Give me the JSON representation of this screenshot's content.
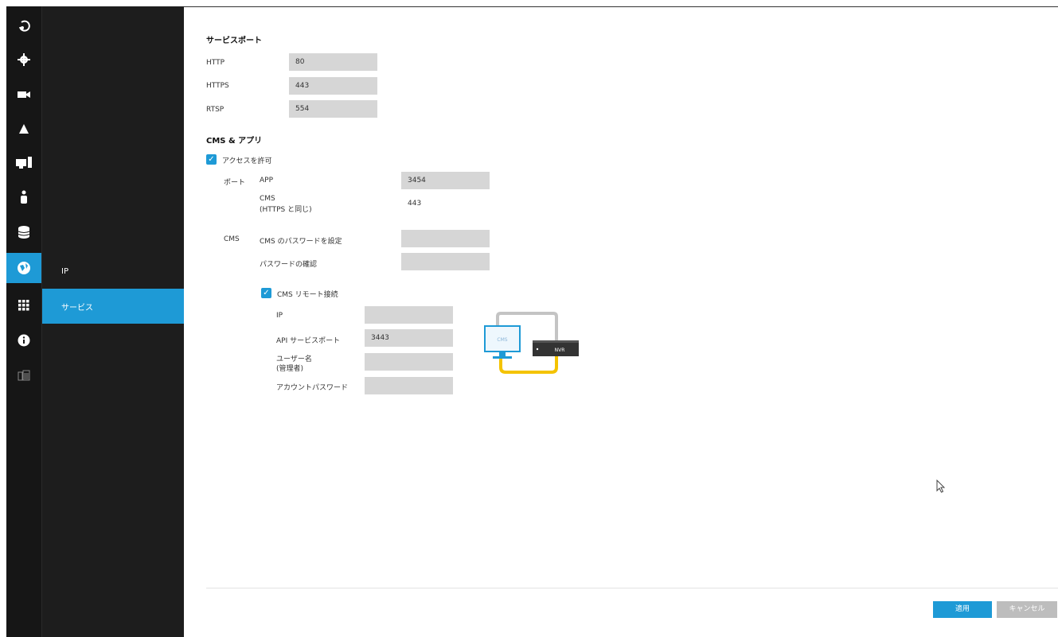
{
  "rail": {
    "icons": [
      "logout-icon",
      "gear-icon",
      "camera-icon",
      "alarm-icon",
      "display-icon",
      "user-icon",
      "storage-icon",
      "network-icon",
      "apps-icon",
      "info-icon",
      "building-icon"
    ]
  },
  "submenu": {
    "items": [
      {
        "label": "IP"
      },
      {
        "label": "サービス"
      }
    ]
  },
  "service_port": {
    "title": "サービスポート",
    "http_label": "HTTP",
    "http_value": "80",
    "https_label": "HTTPS",
    "https_value": "443",
    "rtsp_label": "RTSP",
    "rtsp_value": "554"
  },
  "cms_app": {
    "title": "CMS & アプリ",
    "allow_access_label": "アクセスを許可",
    "port_label": "ポート",
    "app_label": "APP",
    "app_value": "3454",
    "cms_label_line1": "CMS",
    "cms_label_line2": "(HTTPS と同じ)",
    "cms_port_value": "443",
    "cms_section_label": "CMS",
    "cms_password_label": "CMS のパスワードを設定",
    "confirm_password_label": "パスワードの確認",
    "remote_label": "CMS リモート接続",
    "ip_label": "IP",
    "api_port_label": "API サービスポート",
    "api_port_value": "3443",
    "username_line1": "ユーザー名",
    "username_line2": "(管理者)",
    "account_password_label": "アカウントパスワード",
    "diagram_cms": "CMS",
    "diagram_nvr": "NVR"
  },
  "buttons": {
    "apply": "適用",
    "cancel": "キャンセル"
  },
  "colors": {
    "accent": "#1e9ad6",
    "cable_yellow": "#f4c300",
    "cable_gray": "#c4c4c4"
  }
}
